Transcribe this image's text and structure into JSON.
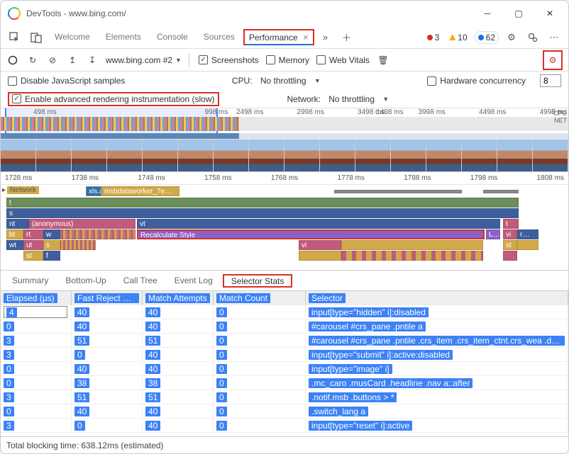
{
  "window": {
    "title": "DevTools - www.bing.com/"
  },
  "mainTabs": [
    "Welcome",
    "Elements",
    "Console",
    "Sources",
    "Performance"
  ],
  "activeMainTab": "Performance",
  "badges": {
    "errors": "3",
    "warnings": "10",
    "info": "62"
  },
  "toolbar": {
    "recording": "www.bing.com #2",
    "screenshots": "Screenshots",
    "memory": "Memory",
    "webvitals": "Web Vitals"
  },
  "settings": {
    "disableJs": "Disable JavaScript samples",
    "advRender": "Enable advanced rendering instrumentation (slow)",
    "cpuLabel": "CPU:",
    "cpuValue": "No throttling",
    "netLabel": "Network:",
    "netValue": "No throttling",
    "hwLabel": "Hardware concurrency",
    "hwValue": "8"
  },
  "overviewTicks": [
    "2498 ms",
    "2998 ms",
    "3498 ms",
    "3998 ms",
    "4498 ms",
    "4998 ms"
  ],
  "overviewSmall": [
    "498 ms",
    "998 ms",
    "1498 ms",
    "8 ms"
  ],
  "ovRight": {
    "cpu": "CPU",
    "net": "NET"
  },
  "rulerTicks": [
    "1728 ms",
    "1738 ms",
    "1748 ms",
    "1758 ms",
    "1768 ms",
    "1778 ms",
    "1788 ms",
    "1798 ms",
    "1808 ms"
  ],
  "flame": {
    "network": "Network",
    "xls": "xls.a",
    "msb": "msbdataworker_7e…",
    "r1": "t",
    "r2": "s",
    "nt": "nt",
    "anon": "(anonymous)",
    "vt": "vt",
    "bt": "bt",
    "rt": "rt",
    "w": "w",
    "recalc": "Recalculate Style",
    "L": "L…",
    "vi": "vi",
    "r": "r…",
    "tt": "t",
    "wt": "wt",
    "ut": "ut",
    "s3": "s",
    "vi2": "vi",
    "st": "st",
    "st2": "st",
    "f": "f"
  },
  "detailTabs": [
    "Summary",
    "Bottom-Up",
    "Call Tree",
    "Event Log",
    "Selector Stats"
  ],
  "activeDetailTab": "Selector Stats",
  "columns": {
    "elapsed": "Elapsed (μs)",
    "fastReject": "Fast Reject Cou…",
    "matchAttempts": "Match Attempts",
    "matchCount": "Match Count",
    "selector": "Selector"
  },
  "rows": [
    {
      "e": "4",
      "f": "40",
      "ma": "40",
      "mc": "0",
      "s": "input[type=\"hidden\" i]:disabled"
    },
    {
      "e": "0",
      "f": "40",
      "ma": "40",
      "mc": "0",
      "s": "#carousel #crs_pane .pntile a"
    },
    {
      "e": "3",
      "f": "51",
      "ma": "51",
      "mc": "0",
      "s": "#carousel #crs_pane .pntile .crs_item .crs_item_ctnt.crs_wea .deg_swit…"
    },
    {
      "e": "3",
      "f": "0",
      "ma": "40",
      "mc": "0",
      "s": "input[type=\"submit\" i]:active:disabled"
    },
    {
      "e": "0",
      "f": "40",
      "ma": "40",
      "mc": "0",
      "s": "input[type=\"image\" i]"
    },
    {
      "e": "0",
      "f": "38",
      "ma": "38",
      "mc": "0",
      "s": ".mc_caro .musCard .headline .nav a::after"
    },
    {
      "e": "3",
      "f": "51",
      "ma": "51",
      "mc": "0",
      "s": ".notif.msb .buttons > *"
    },
    {
      "e": "0",
      "f": "40",
      "ma": "40",
      "mc": "0",
      "s": ".switch_lang a"
    },
    {
      "e": "3",
      "f": "0",
      "ma": "40",
      "mc": "0",
      "s": "input[type=\"reset\" i]:active"
    }
  ],
  "status": "Total blocking time: 638.12ms (estimated)"
}
